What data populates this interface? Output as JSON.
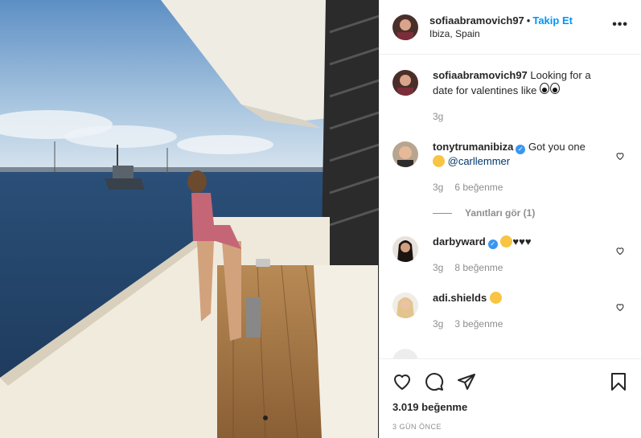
{
  "post": {
    "username": "sofiaabramovich97",
    "separator": "•",
    "follow_label": "Takip Et",
    "location": "Ibiza, Spain",
    "more_label": "•••"
  },
  "caption": {
    "username": "sofiaabramovich97",
    "text": "Looking for a date for valentines like",
    "time": "3g"
  },
  "comments": [
    {
      "username": "tonytrumanibiza",
      "text": "Got you one",
      "mention": "@carllemmer",
      "time": "3g",
      "likes": "6 beğenme",
      "replies": "Yanıtları gör (1)"
    },
    {
      "username": "darbyward",
      "text": "♥♥♥",
      "time": "3g",
      "likes": "8 beğenme"
    },
    {
      "username": "adi.shields",
      "text": "",
      "time": "3g",
      "likes": "3 beğenme"
    }
  ],
  "footer": {
    "likes": "3.019 beğenme",
    "time": "3 GÜN ÖNCE"
  },
  "icons": [
    "like-icon",
    "comment-icon",
    "share-icon",
    "save-icon",
    "verified-icon"
  ],
  "colors": {
    "link": "#0095f6",
    "mention": "#00376b",
    "meta": "#8e8e8e",
    "verified": "#3897f0"
  }
}
